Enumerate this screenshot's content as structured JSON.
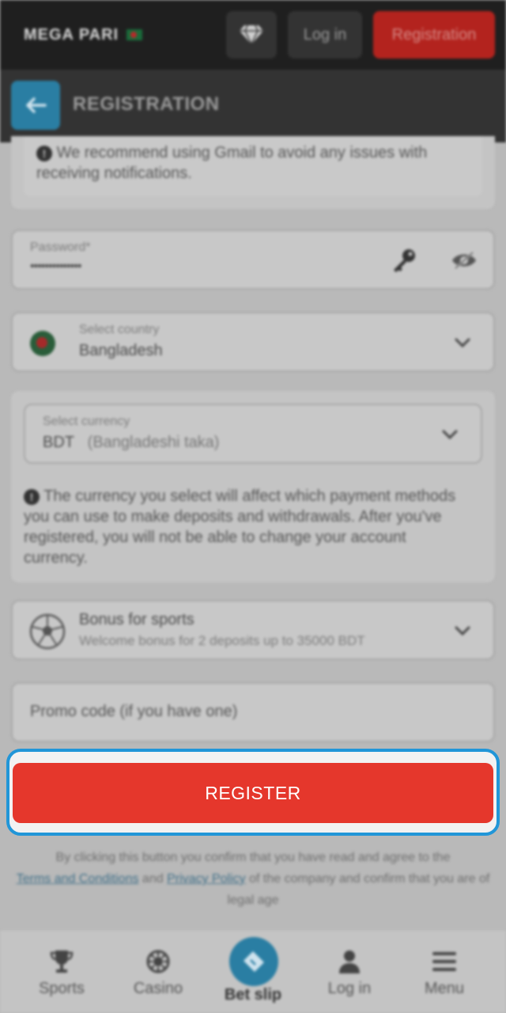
{
  "header": {
    "logo_text": "MEGA PARI",
    "login_label": "Log in",
    "registration_label": "Registration"
  },
  "subheader": {
    "title": "REGISTRATION"
  },
  "email_note": {
    "text": "We recommend using Gmail to avoid any issues with receiving notifications."
  },
  "password": {
    "label": "Password*",
    "value": "••••••••••••••"
  },
  "country": {
    "label": "Select country",
    "value": "Bangladesh"
  },
  "currency": {
    "label": "Select currency",
    "code": "BDT",
    "name": "(Bangladeshi taka)",
    "note": "The currency you select will affect which payment methods you can use to make deposits and withdrawals. After you've registered, you will not be able to change your account currency."
  },
  "bonus": {
    "title": "Bonus for sports",
    "subtitle": "Welcome bonus for 2 deposits up to 35000 BDT"
  },
  "promo": {
    "placeholder": "Promo code (if you have one)"
  },
  "register_button": {
    "label": "REGISTER"
  },
  "terms": {
    "part1": "By clicking this button you confirm that you have read and agree to the",
    "terms_link": "Terms and Conditions",
    "and": "and",
    "privacy_link": "Privacy Policy",
    "part2": "of the company and confirm that you are of legal age"
  },
  "bottom_nav": {
    "sports": "Sports",
    "casino": "Casino",
    "bet_slip": "Bet slip",
    "login": "Log in",
    "menu": "Menu"
  },
  "colors": {
    "accent_red": "#e5372c",
    "highlight_blue": "#2196d8",
    "brand_blue": "#2a7ea3"
  }
}
